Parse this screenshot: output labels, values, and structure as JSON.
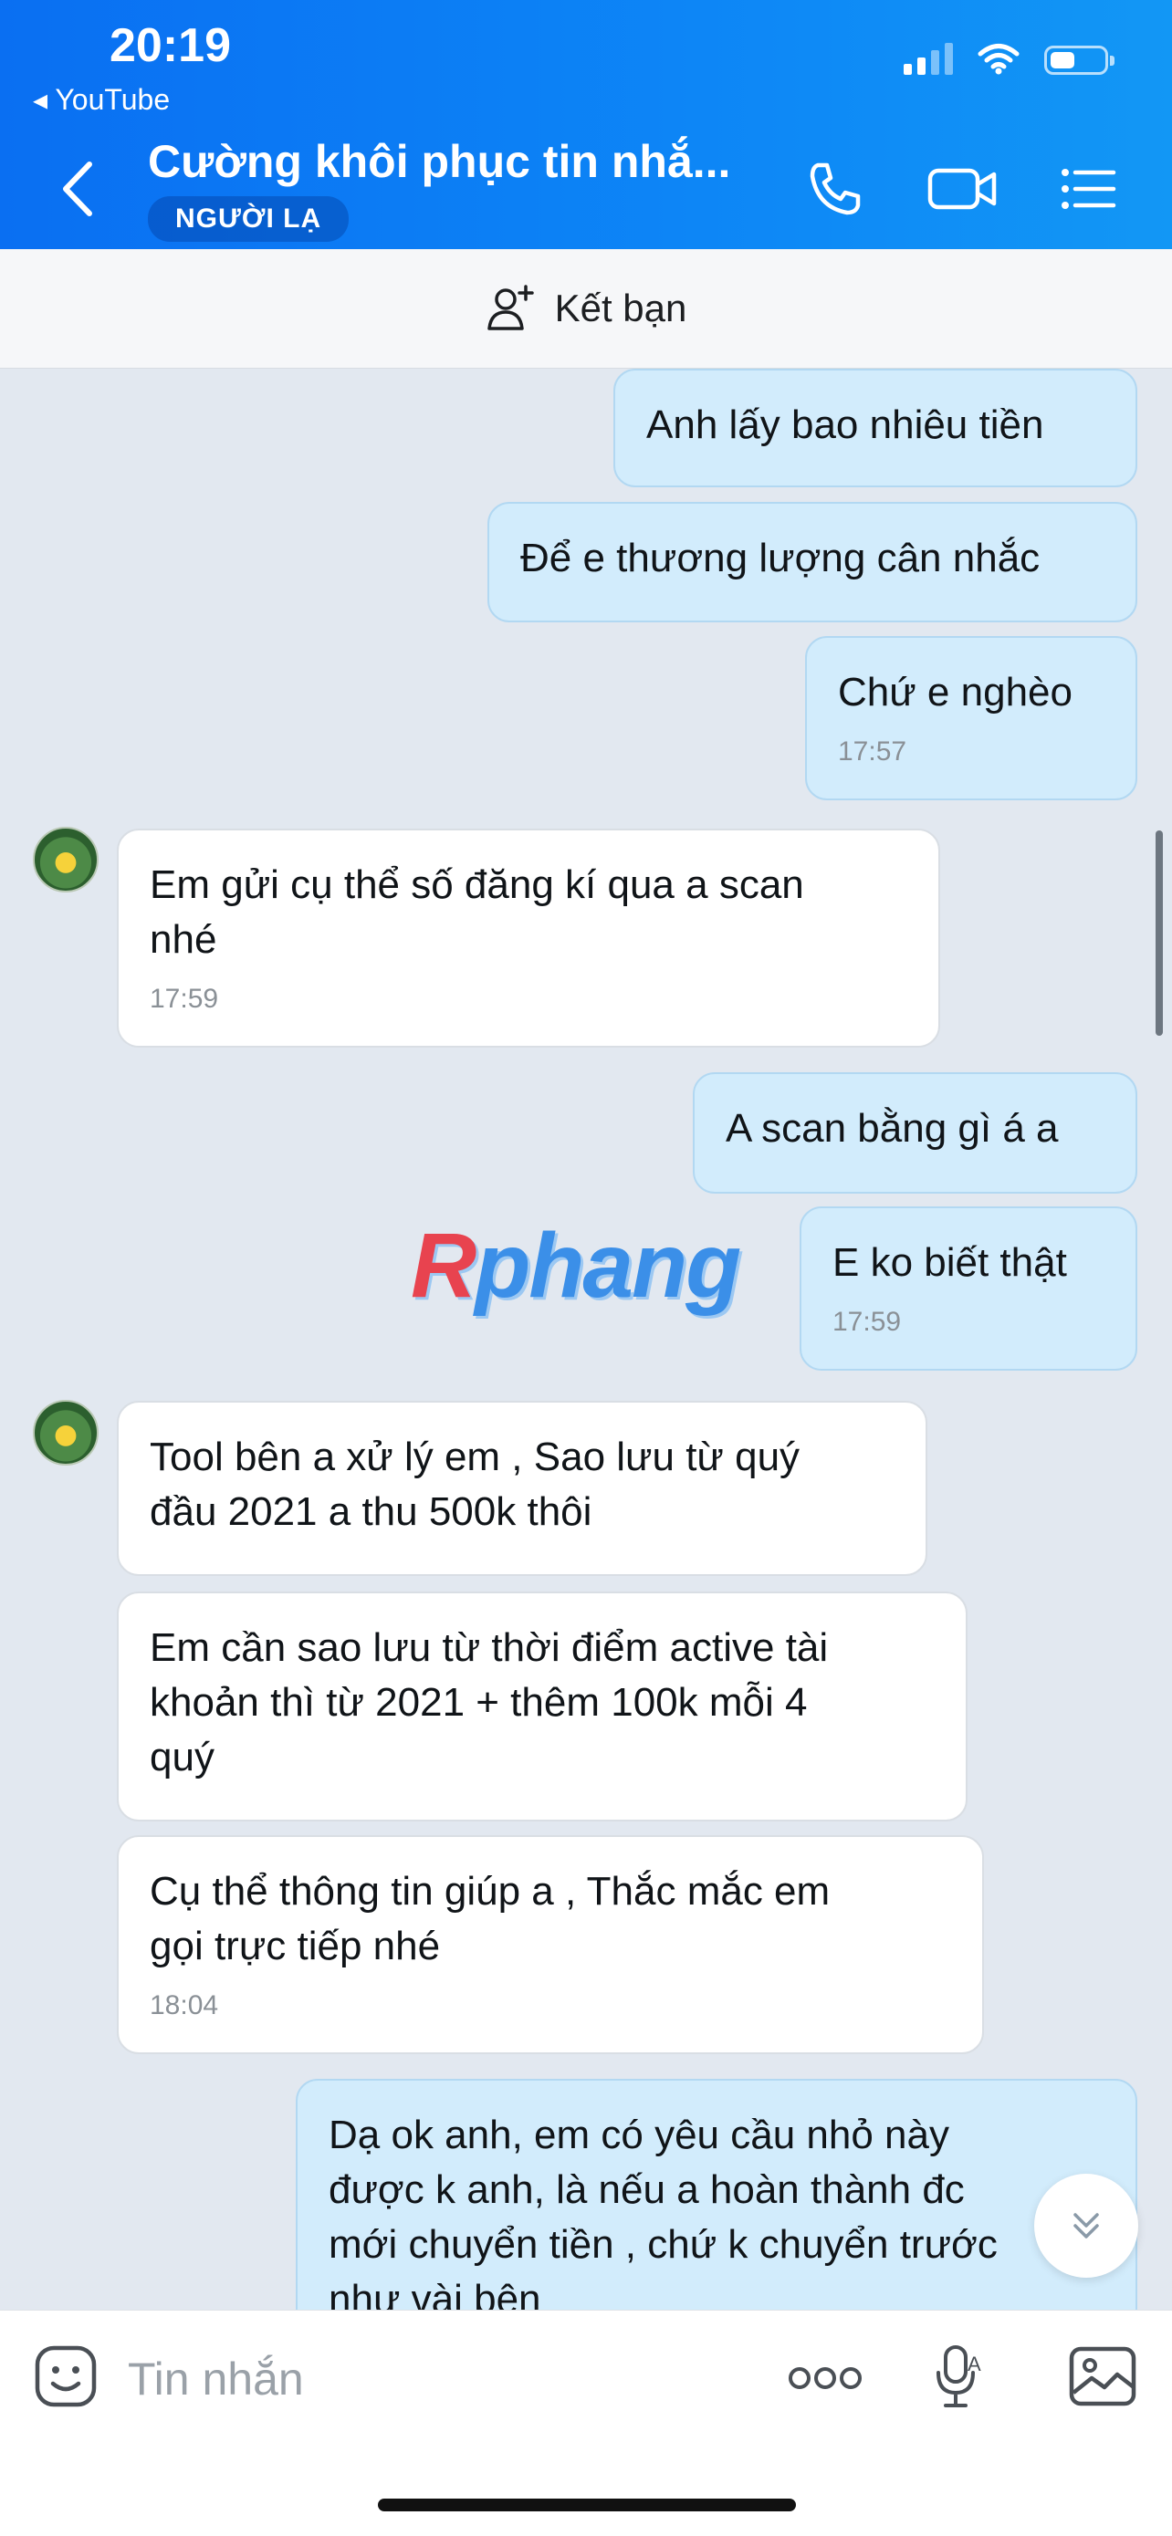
{
  "status_bar": {
    "time": "20:19",
    "back_app": "◂ YouTube"
  },
  "header": {
    "title": "Cường khôi phục tin nhắ...",
    "badge": "NGƯỜI LẠ"
  },
  "subbar": {
    "add_friend_label": "Kết bạn"
  },
  "watermark": {
    "first_letter": "R",
    "rest": "phang"
  },
  "messages": [
    {
      "from": "me",
      "lines": [
        "Anh lấy bao nhiêu tiền"
      ],
      "time": ""
    },
    {
      "from": "me",
      "lines": [
        "Để e thương lượng cân nhắc"
      ],
      "time": ""
    },
    {
      "from": "me",
      "lines": [
        "Chứ e nghèo"
      ],
      "time": "17:57"
    },
    {
      "from": "them",
      "lines": [
        "Em gửi cụ thể số đăng kí qua a scan",
        "nhé"
      ],
      "time": "17:59"
    },
    {
      "from": "me",
      "lines": [
        "A scan bằng gì á a"
      ],
      "time": ""
    },
    {
      "from": "me",
      "lines": [
        "E ko biết thật"
      ],
      "time": "17:59"
    },
    {
      "from": "them",
      "lines": [
        "Tool bên a xử lý em , Sao lưu từ quý",
        "đầu 2021 a thu 500k thôi"
      ],
      "time": ""
    },
    {
      "from": "them",
      "lines": [
        "Em cần sao lưu từ thời điểm active tài",
        "khoản thì từ 2021 + thêm 100k mỗi 4",
        "quý"
      ],
      "time": ""
    },
    {
      "from": "them",
      "lines": [
        "Cụ thể thông tin giúp a , Thắc mắc em",
        "gọi trực tiếp nhé"
      ],
      "time": "18:04"
    },
    {
      "from": "me",
      "lines": [
        "Dạ ok anh, em có yêu cầu nhỏ này",
        "được k anh, là nếu a hoàn thành đc",
        "mới chuyển tiền , chứ k chuyển trước",
        "như vài bên"
      ],
      "time": ""
    }
  ],
  "composer": {
    "placeholder": "Tin nhắn"
  },
  "icons": {
    "back": "chevron-left-icon",
    "call": "phone-icon",
    "video": "video-camera-icon",
    "menu": "list-menu-icon",
    "add_friend": "add-user-icon",
    "emoji": "sticker-icon",
    "more": "more-dots-icon",
    "voice": "voice-text-icon",
    "image": "image-icon",
    "scroll_down": "chevron-double-down-icon"
  },
  "colors": {
    "header": "#0d86f6",
    "my_bubble": "#d2ecfc",
    "their_bubble": "#ffffff",
    "chat_bg": "#e2e8f0"
  }
}
